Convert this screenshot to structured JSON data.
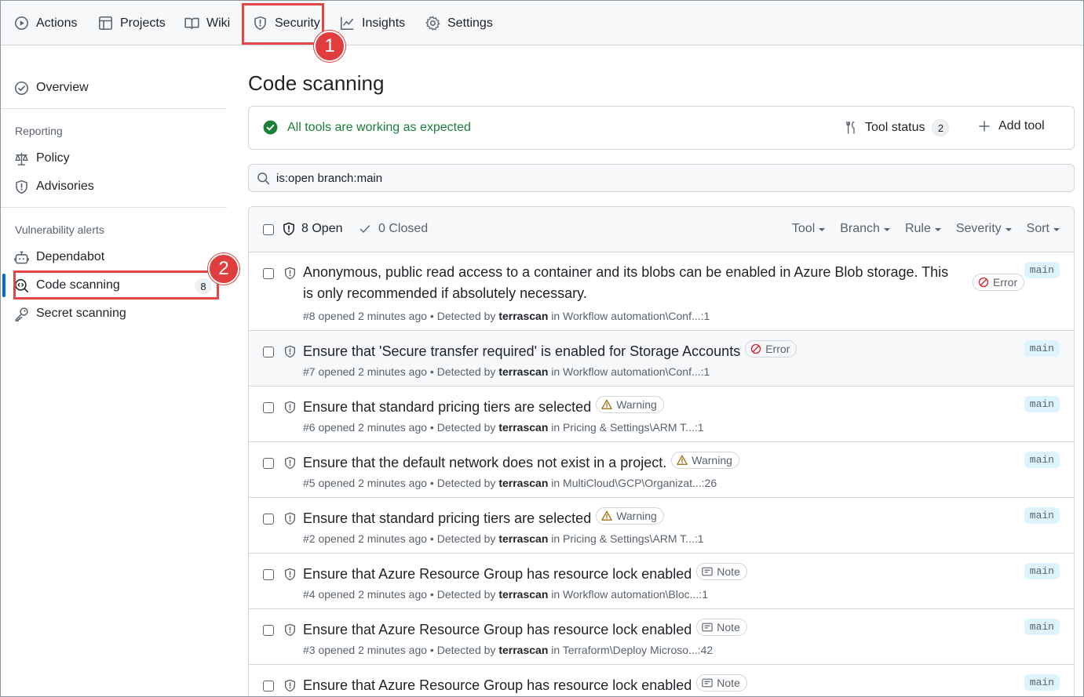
{
  "topnav": {
    "items": [
      {
        "label": "Actions",
        "icon": "play-icon"
      },
      {
        "label": "Projects",
        "icon": "table-icon"
      },
      {
        "label": "Wiki",
        "icon": "book-icon"
      },
      {
        "label": "Security",
        "icon": "shield-icon"
      },
      {
        "label": "Insights",
        "icon": "graph-icon"
      },
      {
        "label": "Settings",
        "icon": "gear-icon"
      }
    ]
  },
  "callouts": [
    "1",
    "2"
  ],
  "sidebar": {
    "overview": "Overview",
    "reporting_heading": "Reporting",
    "policy": "Policy",
    "advisories": "Advisories",
    "vuln_heading": "Vulnerability alerts",
    "dependabot": "Dependabot",
    "code_scanning": "Code scanning",
    "code_scanning_count": "8",
    "secret_scanning": "Secret scanning"
  },
  "main": {
    "title": "Code scanning",
    "tools_ok": "All tools are working as expected",
    "tool_status_label": "Tool status",
    "tool_status_count": "2",
    "add_tool_label": "Add tool",
    "search_value": "is:open branch:main",
    "open_label": "8 Open",
    "closed_label": "0 Closed",
    "filters": [
      "Tool",
      "Branch",
      "Rule",
      "Severity",
      "Sort"
    ]
  },
  "alerts": [
    {
      "title_line1": "Anonymous, public read access to a container and its blobs can be enabled in Azure Blob storage. This",
      "title_line2": "is only recommended if absolutely necessary.",
      "severity": "Error",
      "number": "#8",
      "opened": "opened 2 minutes ago",
      "detected": "Detected by",
      "tool": "terrascan",
      "location": "in Workflow automation\\Conf...:1",
      "branch": "main"
    },
    {
      "title": "Ensure that 'Secure transfer required' is enabled for Storage Accounts",
      "severity": "Error",
      "number": "#7",
      "opened": "opened 2 minutes ago",
      "detected": "Detected by",
      "tool": "terrascan",
      "location": "in Workflow automation\\Conf...:1",
      "branch": "main"
    },
    {
      "title": "Ensure that standard pricing tiers are selected",
      "severity": "Warning",
      "number": "#6",
      "opened": "opened 2 minutes ago",
      "detected": "Detected by",
      "tool": "terrascan",
      "location": "in Pricing & Settings\\ARM T...:1",
      "branch": "main"
    },
    {
      "title": "Ensure that the default network does not exist in a project.",
      "severity": "Warning",
      "number": "#5",
      "opened": "opened 2 minutes ago",
      "detected": "Detected by",
      "tool": "terrascan",
      "location": "in MultiCloud\\GCP\\Organizat...:26",
      "branch": "main"
    },
    {
      "title": "Ensure that standard pricing tiers are selected",
      "severity": "Warning",
      "number": "#2",
      "opened": "opened 2 minutes ago",
      "detected": "Detected by",
      "tool": "terrascan",
      "location": "in Pricing & Settings\\ARM T...:1",
      "branch": "main"
    },
    {
      "title": "Ensure that Azure Resource Group has resource lock enabled",
      "severity": "Note",
      "number": "#4",
      "opened": "opened 2 minutes ago",
      "detected": "Detected by",
      "tool": "terrascan",
      "location": "in Workflow automation\\Bloc...:1",
      "branch": "main"
    },
    {
      "title": "Ensure that Azure Resource Group has resource lock enabled",
      "severity": "Note",
      "number": "#3",
      "opened": "opened 2 minutes ago",
      "detected": "Detected by",
      "tool": "terrascan",
      "location": "in Terraform\\Deploy Microso...:42",
      "branch": "main"
    },
    {
      "title": "Ensure that Azure Resource Group has resource lock enabled",
      "severity": "Note",
      "branch": "main"
    }
  ],
  "colors": {
    "accent": "#0969da",
    "success": "#1a7f37",
    "error": "#cf222e",
    "warning": "#9a6700",
    "highlight": "#e34646"
  }
}
